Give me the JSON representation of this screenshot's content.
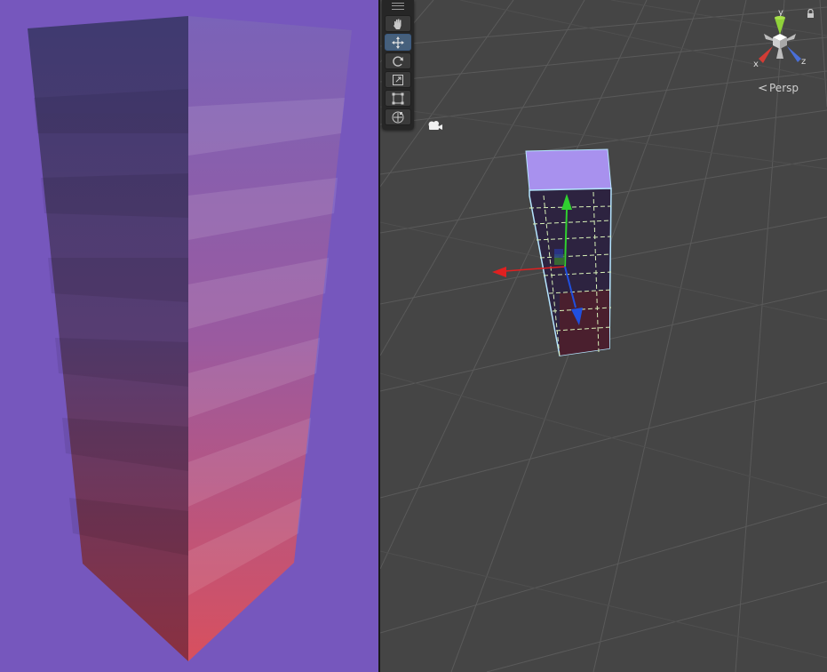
{
  "game_view": {
    "object": "tall-box",
    "background_color": "#7657bd"
  },
  "scene_view": {
    "projection_label": "Persp",
    "background_color": "#454545",
    "toolbar": {
      "tools": [
        {
          "name": "hand-tool",
          "icon": "hand-icon",
          "active": false
        },
        {
          "name": "move-tool",
          "icon": "move-icon",
          "active": true
        },
        {
          "name": "rotate-tool",
          "icon": "rotate-icon",
          "active": false
        },
        {
          "name": "scale-tool",
          "icon": "scale-icon",
          "active": false
        },
        {
          "name": "rect-tool",
          "icon": "rect-icon",
          "active": false
        },
        {
          "name": "transform-tool",
          "icon": "transform-icon",
          "active": false
        }
      ]
    },
    "gizmo": {
      "axes": [
        {
          "label": "y",
          "color": "#8fd13a"
        },
        {
          "label": "x",
          "color": "#d23c35"
        },
        {
          "label": "z",
          "color": "#4a6fd8"
        }
      ]
    },
    "handle_colors": {
      "x": "#e02020",
      "y": "#30d030",
      "z": "#2050e0"
    }
  }
}
